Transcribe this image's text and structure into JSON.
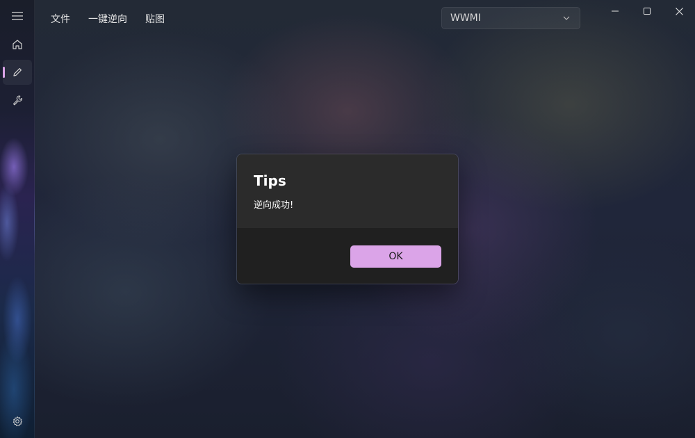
{
  "menu": {
    "items": [
      {
        "label": "文件"
      },
      {
        "label": "一键逆向"
      },
      {
        "label": "贴图"
      }
    ]
  },
  "game_select": {
    "selected": "WWMI"
  },
  "nav": {
    "items": [
      {
        "icon": "home-icon"
      },
      {
        "icon": "edit-icon",
        "active": true
      },
      {
        "icon": "wrench-icon"
      }
    ],
    "footer_icon": "settings-icon"
  },
  "dialog": {
    "title": "Tips",
    "message": "逆向成功!",
    "ok_label": "OK"
  },
  "colors": {
    "accent": "#dba4e8",
    "dialog_body": "#2b2b2b",
    "dialog_footer": "#202020"
  }
}
